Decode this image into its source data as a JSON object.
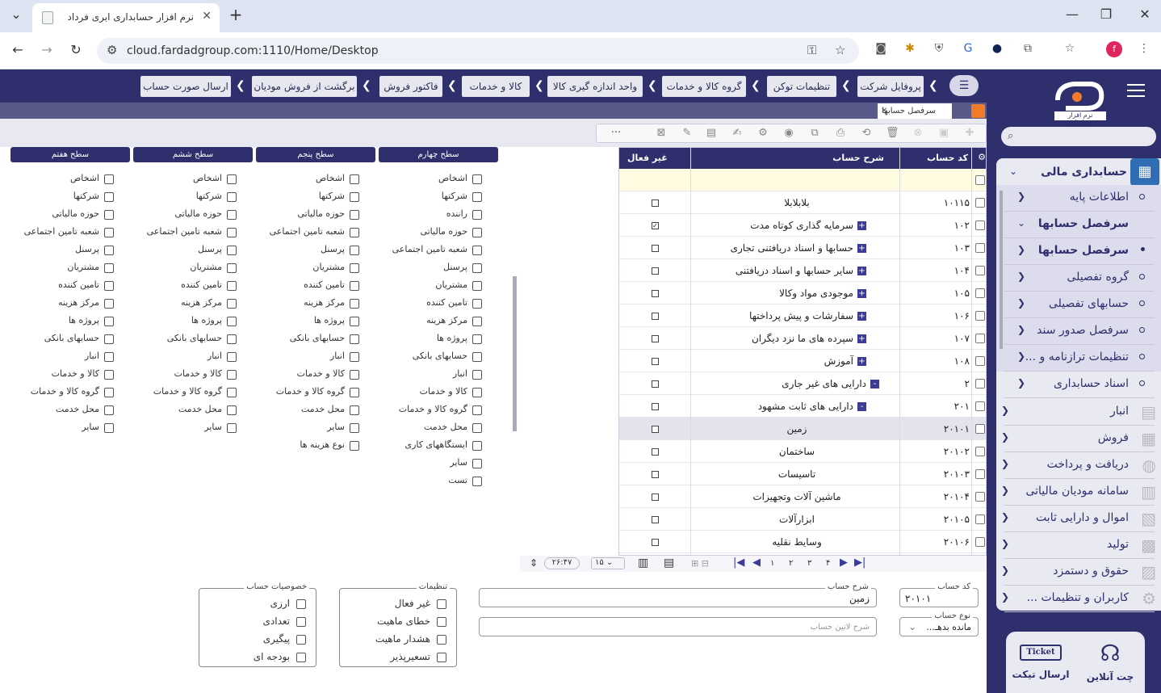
{
  "browser": {
    "tab_title": "نرم افزار حسابداری ابری فرداد",
    "url": "cloud.fardadgroup.com:1110/Home/Desktop",
    "new_tab": "+",
    "profile_initial": "f"
  },
  "breadcrumbs": [
    "پروفایل شرکت",
    "تنظیمات توکن",
    "گروه کالا و خدمات",
    "واحد اندازه گیری کالا",
    "کالا و خدمات",
    "فاکتور فروش",
    "برگشت از فروش مودیان",
    "ارسال صورت حساب"
  ],
  "app_tab": "سرفصل حسابها",
  "grid": {
    "headers": {
      "code": "کد حساب",
      "desc": "شرح حساب",
      "inactive": "غیر فعال"
    },
    "rows": [
      {
        "code": "۱۰۱۱۵",
        "desc": "بلابلابلا",
        "inactive": false,
        "exp": ""
      },
      {
        "code": "۱۰۲",
        "desc": "سرمایه گذاری کوتاه مدت",
        "inactive": true,
        "exp": "+"
      },
      {
        "code": "۱۰۳",
        "desc": "حسابها و اسناد دریافتنی تجاری",
        "inactive": false,
        "exp": "+"
      },
      {
        "code": "۱۰۴",
        "desc": "سایر حسابها و اسناد دریافتنی",
        "inactive": false,
        "exp": "+"
      },
      {
        "code": "۱۰۵",
        "desc": "موجودی مواد وکالا",
        "inactive": false,
        "exp": "+"
      },
      {
        "code": "۱۰۶",
        "desc": "سفارشات و پیش پرداختها",
        "inactive": false,
        "exp": "+"
      },
      {
        "code": "۱۰۷",
        "desc": "سپرده های ما نزد دیگران",
        "inactive": false,
        "exp": "+"
      },
      {
        "code": "۱۰۸",
        "desc": "آموزش",
        "inactive": false,
        "exp": "+"
      },
      {
        "code": "۲",
        "desc": "دارایی های غیر جاری",
        "inactive": false,
        "exp": "-"
      },
      {
        "code": "۲۰۱",
        "desc": "دارایی های ثابت مشهود",
        "inactive": false,
        "exp": "-"
      },
      {
        "code": "۲۰۱۰۱",
        "desc": "زمین",
        "inactive": false,
        "exp": ""
      },
      {
        "code": "۲۰۱۰۲",
        "desc": "ساختمان",
        "inactive": false,
        "exp": ""
      },
      {
        "code": "۲۰۱۰۳",
        "desc": "تاسیسات",
        "inactive": false,
        "exp": ""
      },
      {
        "code": "۲۰۱۰۴",
        "desc": "ماشین آلات وتجهیزات",
        "inactive": false,
        "exp": ""
      },
      {
        "code": "۲۰۱۰۵",
        "desc": "ابزارآلات",
        "inactive": false,
        "exp": ""
      },
      {
        "code": "۲۰۱۰۶",
        "desc": "وسایط نقلیه",
        "inactive": false,
        "exp": ""
      }
    ]
  },
  "pager": {
    "pages": [
      "۱",
      "۲",
      "۳",
      "۴"
    ],
    "page_size": "۱۵",
    "time": "۲۶:۴۷"
  },
  "levels": [
    {
      "title": "سطح چهارم",
      "items": [
        "اشخاص",
        "شرکتها",
        "راننده",
        "حوزه مالیاتی",
        "شعبه تامین اجتماعی",
        "پرسنل",
        "مشتریان",
        "تامین کننده",
        "مرکز هزینه",
        "پروژه ها",
        "حسابهای بانکی",
        "انبار",
        "کالا و خدمات",
        "گروه کالا و خدمات",
        "محل خدمت",
        "ایستگاههای کاری",
        "سایر",
        "تست"
      ]
    },
    {
      "title": "سطح پنجم",
      "items": [
        "اشخاص",
        "شرکتها",
        "حوزه مالیاتی",
        "شعبه تامین اجتماعی",
        "پرسنل",
        "مشتریان",
        "تامین کننده",
        "مرکز هزینه",
        "پروژه ها",
        "حسابهای بانکی",
        "انبار",
        "کالا و خدمات",
        "گروه کالا و خدمات",
        "محل خدمت",
        "سایر",
        "نوع هزینه ها"
      ]
    },
    {
      "title": "سطح ششم",
      "items": [
        "اشخاص",
        "شرکتها",
        "حوزه مالیاتی",
        "شعبه تامین اجتماعی",
        "پرسنل",
        "مشتریان",
        "تامین کننده",
        "مرکز هزینه",
        "پروژه ها",
        "حسابهای بانکی",
        "انبار",
        "کالا و خدمات",
        "گروه کالا و خدمات",
        "محل خدمت",
        "سایر"
      ]
    },
    {
      "title": "سطح هفتم",
      "items": [
        "اشخاص",
        "شرکتها",
        "حوزه مالیاتی",
        "شعبه تامین اجتماعی",
        "پرسنل",
        "مشتریان",
        "تامین کننده",
        "مرکز هزینه",
        "پروژه ها",
        "حسابهای بانکی",
        "انبار",
        "کالا و خدمات",
        "گروه کالا و خدمات",
        "محل خدمت",
        "سایر"
      ]
    }
  ],
  "form": {
    "code_label": "کد حساب",
    "code_value": "۲۰۱۰۱",
    "desc_label": "شرح حساب",
    "desc_value": "زمین",
    "type_label": "نوع حساب",
    "type_value": "مانده بدهـ...",
    "latin_placeholder": "شرح لاتین حساب",
    "settings_title": "تنظیمات",
    "settings": [
      "غیر فعال",
      "خطای ماهیت",
      "هشدار ماهیت",
      "تسعیرپذیر"
    ],
    "props_title": "خصوصیات حساب",
    "props": [
      "ارزی",
      "تعدادی",
      "پیگیری",
      "بودجه ای"
    ]
  },
  "sidebar": {
    "logo_text": "نرم افزار حسابداری",
    "search_placeholder": "",
    "header": "حسابداری مالی",
    "items": [
      {
        "label": "اطلاعات پایه",
        "sub": true
      },
      {
        "label": "سرفصل حسابها",
        "sub": true,
        "bold": true,
        "open": true
      },
      {
        "label": "سرفصل حسابها",
        "sub": true,
        "bold": true,
        "active": true
      },
      {
        "label": "گروه تفصیلی",
        "sub": true
      },
      {
        "label": "حسابهای تفصیلی",
        "sub": true
      },
      {
        "label": "سرفصل صدور سند",
        "sub": true
      },
      {
        "label": "تنظیمات ترازنامه و ...",
        "sub": true
      },
      {
        "label": "اسناد حسابداری",
        "sub": false
      }
    ],
    "modules": [
      "انبار",
      "فروش",
      "دریافت و پرداخت",
      "سامانه مودیان مالیاتی",
      "اموال و دارایی ثابت",
      "تولید",
      "حقوق و دستمزد",
      "کاربران و تنظیمات ..."
    ],
    "support": {
      "chat": "چت آنلاین",
      "ticket": "ارسال تیکت",
      "ticket_badge": "Ticket"
    }
  }
}
